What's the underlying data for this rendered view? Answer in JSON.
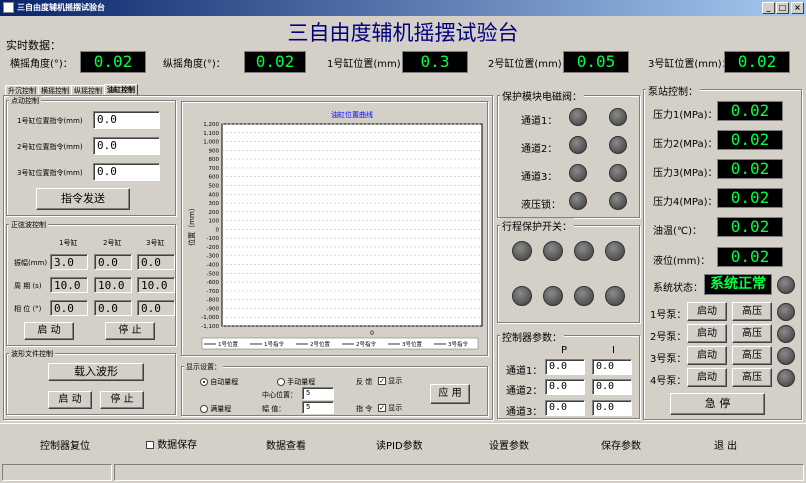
{
  "window": {
    "title": "三自由度辅机摇摆试验台"
  },
  "header": {
    "title": "三自由度辅机摇摆试验台"
  },
  "realtime": {
    "label": "实时数据：",
    "items": [
      {
        "label": "横摇角度(°)：",
        "value": "0.02"
      },
      {
        "label": "纵摇角度(°)：",
        "value": "0.02"
      },
      {
        "label": "1号缸位置(mm)：",
        "value": "0.3"
      },
      {
        "label": "2号缸位置(mm)：",
        "value": "0.05"
      },
      {
        "label": "3号缸位置(mm)：",
        "value": "0.02"
      }
    ]
  },
  "tabs": [
    "升沉控制",
    "横摇控制",
    "纵摇控制",
    "油缸控制"
  ],
  "point_control": {
    "label": "点动控制",
    "rows": [
      {
        "label": "1号缸位置指令(mm)",
        "value": "0.0"
      },
      {
        "label": "2号缸位置指令(mm)",
        "value": "0.0"
      },
      {
        "label": "3号缸位置指令(mm)",
        "value": "0.0"
      }
    ],
    "send": "指令发送"
  },
  "sine_control": {
    "label": "正弦波控制",
    "cols": [
      "1号缸",
      "2号缸",
      "3号缸"
    ],
    "rows": [
      {
        "label": "振幅(mm)",
        "values": [
          "3.0",
          "0.0",
          "0.0"
        ]
      },
      {
        "label": "周 期 (s)",
        "values": [
          "10.0",
          "10.0",
          "10.0"
        ]
      },
      {
        "label": "相 位 (°)",
        "values": [
          "0.0",
          "0.0",
          "0.0"
        ]
      }
    ],
    "start": "启  动",
    "stop": "停  止"
  },
  "wave_control": {
    "label": "波形文件控制",
    "load": "载入波形",
    "start": "启 动",
    "stop": "停 止"
  },
  "chart_data": {
    "type": "line",
    "title": "油缸位置曲线",
    "ylabel": "位置（mm）",
    "ylim": [
      -1100,
      1200
    ],
    "yticks": [
      "1,200",
      "1,100",
      "1,000",
      "900",
      "800",
      "700",
      "600",
      "500",
      "400",
      "300",
      "200",
      "100",
      "0",
      "-100",
      "-200",
      "-300",
      "-400",
      "-500",
      "-600",
      "-700",
      "-800",
      "-900",
      "-1,000",
      "-1,100"
    ],
    "xticks": [
      "0"
    ],
    "grid": true,
    "legend_placement": "bottom",
    "series": [
      {
        "name": "1号位置",
        "values": []
      },
      {
        "name": "1号指令",
        "values": []
      },
      {
        "name": "2号位置",
        "values": []
      },
      {
        "name": "2号指令",
        "values": []
      },
      {
        "name": "3号位置",
        "values": []
      },
      {
        "name": "3号指令",
        "values": []
      }
    ]
  },
  "display": {
    "label": "显示设置：",
    "auto": "自动量程",
    "manual": "手动量程",
    "full": "满量程",
    "center_label": "中心位置：",
    "center_value": "5",
    "amp_label": "幅  值：",
    "amp_value": "5",
    "feedback_label": "反 馈",
    "feedback_show": "显示",
    "command_label": "指 令",
    "command_show": "显示",
    "apply": "应 用"
  },
  "valve": {
    "label": "保护模块电磁阀：",
    "rows": [
      "通道1：",
      "通道2：",
      "通道3：",
      "液压锁："
    ]
  },
  "travel": {
    "label": "行程保护开关："
  },
  "pid": {
    "label": "控制器参数：",
    "cols": [
      "P",
      "I"
    ],
    "rows": [
      {
        "label": "通道1：",
        "p": "0.0",
        "i": "0.0"
      },
      {
        "label": "通道2：",
        "p": "0.0",
        "i": "0.0"
      },
      {
        "label": "通道3：",
        "p": "0.0",
        "i": "0.0"
      }
    ]
  },
  "pump": {
    "label": "泵站控制：",
    "readings": [
      {
        "label": "压力1(MPa)：",
        "value": "0.02"
      },
      {
        "label": "压力2(MPa)：",
        "value": "0.02"
      },
      {
        "label": "压力3(MPa)：",
        "value": "0.02"
      },
      {
        "label": "压力4(MPa)：",
        "value": "0.02"
      },
      {
        "label": "油温(℃)：",
        "value": "0.02"
      },
      {
        "label": "液位(mm)：",
        "value": "0.02"
      }
    ],
    "status_label": "系统状态：",
    "status_value": "系统正常",
    "pumps": [
      {
        "label": "1号泵：",
        "start": "启动",
        "high": "高压"
      },
      {
        "label": "2号泵：",
        "start": "启动",
        "high": "高压"
      },
      {
        "label": "3号泵：",
        "start": "启动",
        "high": "高压"
      },
      {
        "label": "4号泵：",
        "start": "启动",
        "high": "高压"
      }
    ],
    "estop": "急  停"
  },
  "bottom": {
    "reset": "控制器复位",
    "save": "数据保存",
    "view": "数据查看",
    "read_pid": "读PID参数",
    "set_params": "设置参数",
    "save_params": "保存参数",
    "exit": "退  出"
  },
  "colors": {
    "lcd_text": "#00ff40",
    "status_text": "#00ff40",
    "title_text": "#000080",
    "chart_title": "#0000ff"
  }
}
